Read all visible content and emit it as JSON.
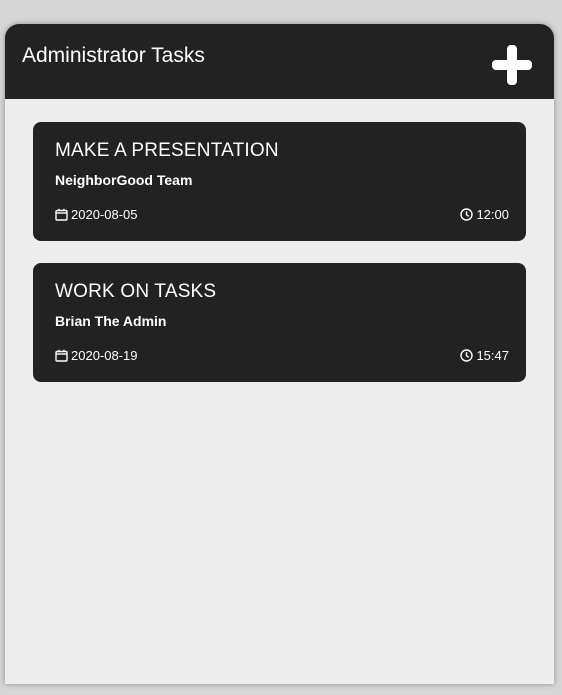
{
  "header": {
    "title": "Administrator Tasks",
    "add_icon": "plus-icon"
  },
  "tasks": [
    {
      "title": "MAKE A PRESENTATION",
      "owner": "NeighborGood Team",
      "date": "2020-08-05",
      "time": "12:00",
      "date_icon": "calendar-icon",
      "time_icon": "clock-icon"
    },
    {
      "title": "WORK ON TASKS",
      "owner": "Brian The Admin",
      "date": "2020-08-19",
      "time": "15:47",
      "date_icon": "calendar-icon",
      "time_icon": "clock-icon"
    }
  ],
  "colors": {
    "header_bg": "#222223",
    "card_bg": "#222223",
    "panel_bg": "#ededed",
    "text": "#ffffff"
  }
}
